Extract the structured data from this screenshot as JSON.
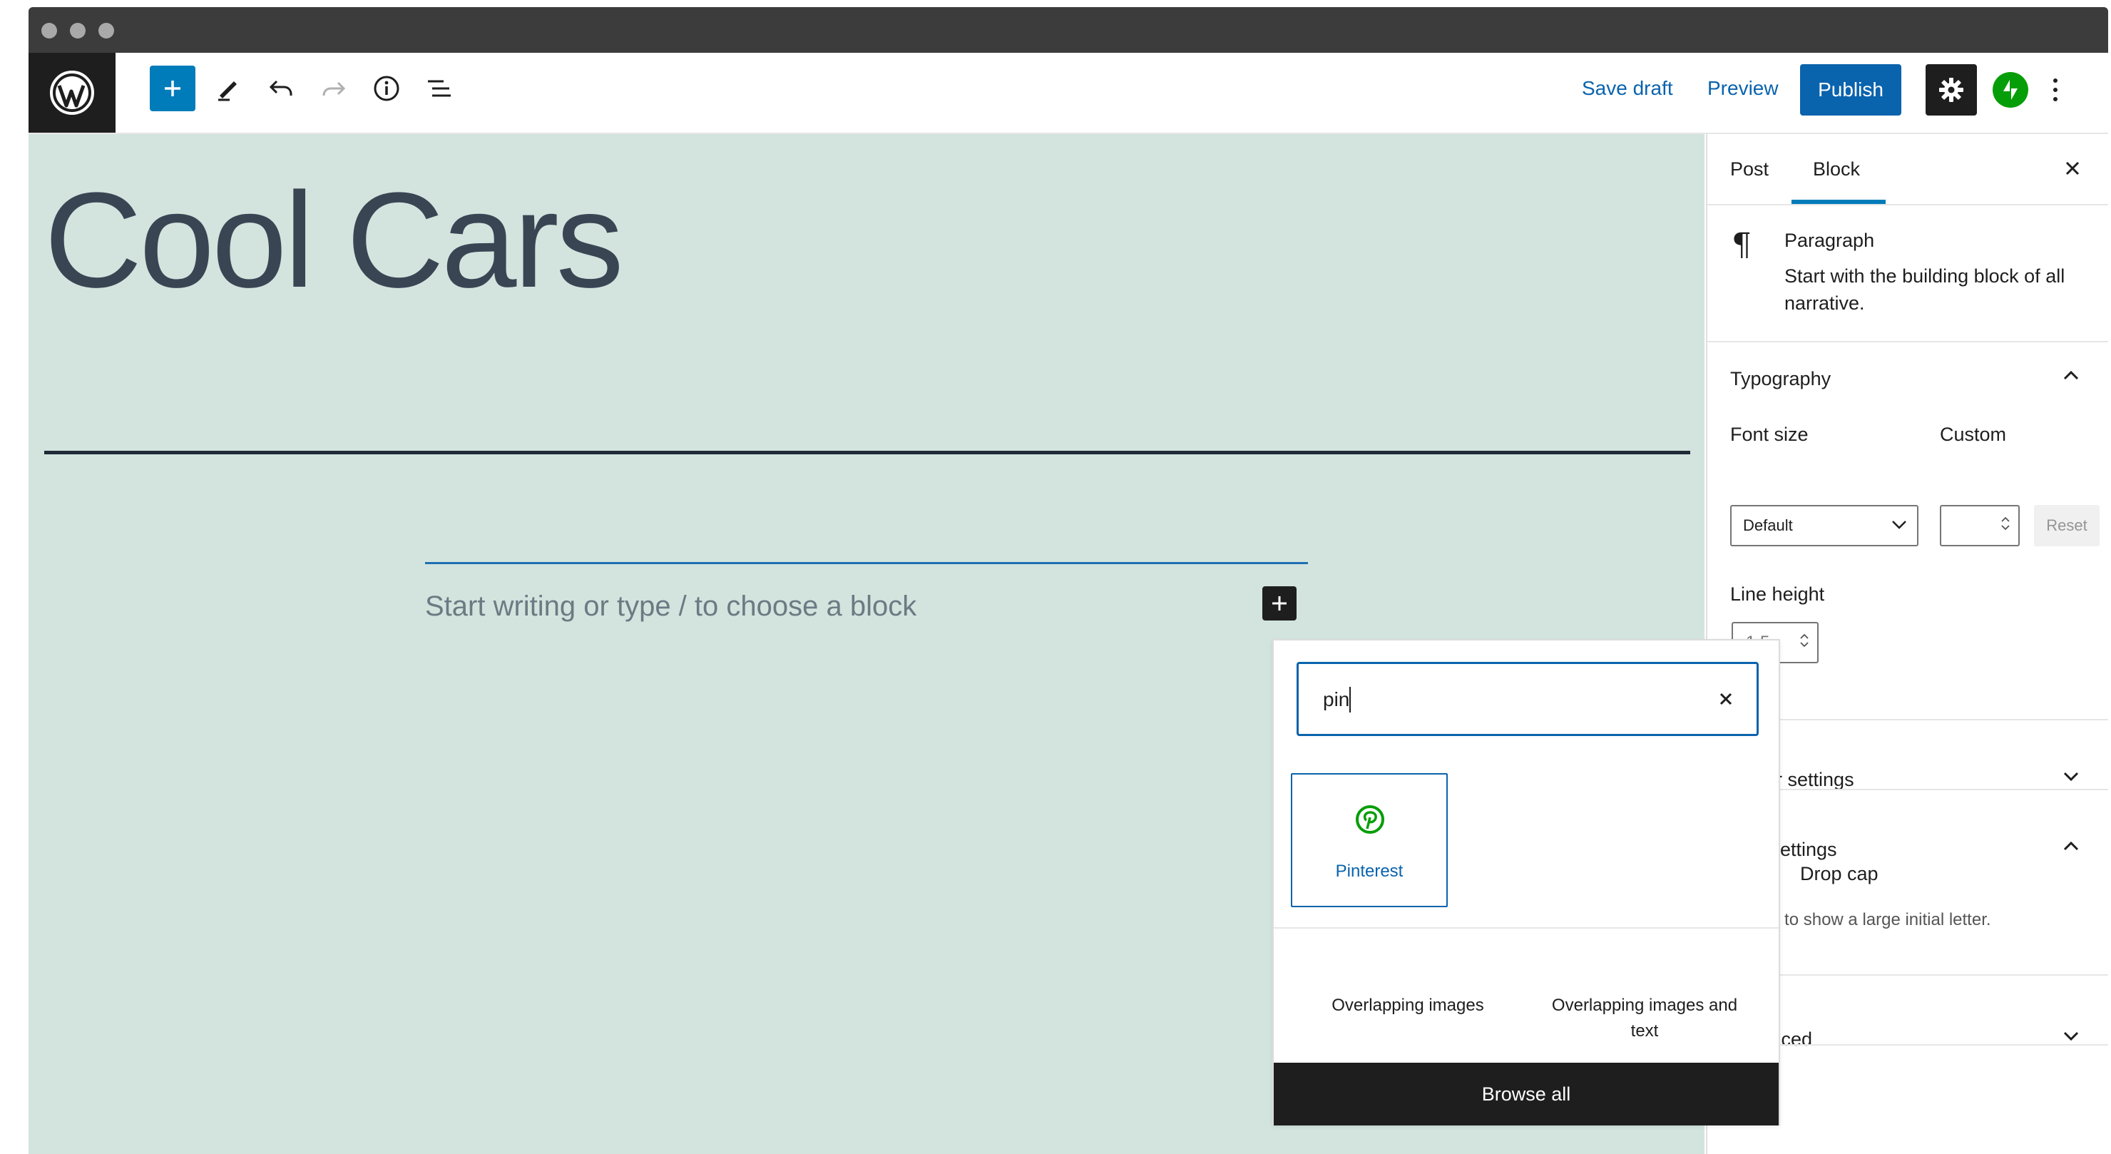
{
  "toolbar": {
    "save_draft": "Save draft",
    "preview": "Preview",
    "publish": "Publish"
  },
  "editor": {
    "post_title": "Cool Cars",
    "placeholder": "Start writing or type / to choose a block"
  },
  "sidebar": {
    "tabs": [
      "Post",
      "Block"
    ],
    "active_tab": "Block",
    "block_card": {
      "title": "Paragraph",
      "description": "Start with the building block of all narrative."
    },
    "typography": {
      "title": "Typography",
      "font_size_label": "Font size",
      "custom_label": "Custom",
      "font_size_value": "Default",
      "reset_label": "Reset",
      "line_height_label": "Line height",
      "line_height_value": "1.5"
    },
    "color_settings": "olor settings",
    "text_settings": {
      "title": "xt settings",
      "drop_cap_label": "Drop cap",
      "drop_cap_help": "ggle to show a large initial letter."
    },
    "advanced": "vanced"
  },
  "inserter": {
    "search_value": "pin",
    "result": {
      "label": "Pinterest",
      "icon": "pinterest-icon"
    },
    "patterns": [
      "Overlapping images",
      "Overlapping images and text"
    ],
    "browse_all": "Browse all"
  },
  "colors": {
    "accent": "#007cba",
    "link": "#0a63ad",
    "canvas": "#d3e4de",
    "jetpack": "#069e08",
    "pinterest": "#069e08"
  }
}
